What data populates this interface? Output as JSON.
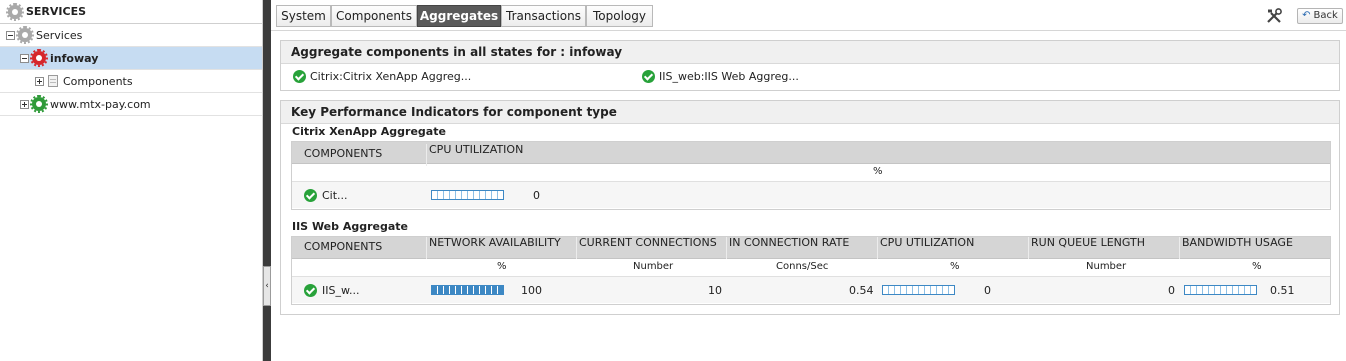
{
  "sidebar": {
    "title": "SERVICES",
    "tree": [
      {
        "label": "Services"
      },
      {
        "label": "infoway"
      },
      {
        "label": "Components"
      },
      {
        "label": "www.mtx-pay.com"
      }
    ]
  },
  "tabs": [
    {
      "label": "System"
    },
    {
      "label": "Components"
    },
    {
      "label": "Aggregates"
    },
    {
      "label": "Transactions"
    },
    {
      "label": "Topology"
    }
  ],
  "toolbar": {
    "back_label": "Back"
  },
  "aggregates_panel": {
    "title": "Aggregate components in all states for : infoway",
    "items": [
      {
        "label": "Citrix:Citrix XenApp Aggreg..."
      },
      {
        "label": "IIS_web:IIS Web Aggreg..."
      }
    ]
  },
  "kpi_panel": {
    "title": "Key Performance Indicators for component type",
    "citrix": {
      "title": "Citrix XenApp Aggregate",
      "columns": [
        "COMPONENTS",
        "CPU UTILIZATION"
      ],
      "units": [
        "",
        "%"
      ],
      "row": {
        "component": "Cit...",
        "cpu_value": "0",
        "cpu_level": 0
      }
    },
    "iis": {
      "title": "IIS Web Aggregate",
      "columns": [
        "COMPONENTS",
        "NETWORK AVAILABILITY",
        "CURRENT CONNECTIONS",
        "IN CONNECTION RATE",
        "CPU UTILIZATION",
        "RUN QUEUE LENGTH",
        "BANDWIDTH USAGE"
      ],
      "units": [
        "",
        "%",
        "Number",
        "Conns/Sec",
        "%",
        "Number",
        "%"
      ],
      "row": {
        "component": "IIS_w...",
        "network_availability": "100",
        "network_availability_level": 1.0,
        "current_connections": "10",
        "in_connection_rate": "0.54",
        "cpu_utilization": "0",
        "cpu_level": 0,
        "run_queue_length": "0",
        "bandwidth_usage": "0.51",
        "bandwidth_level": 0
      }
    }
  },
  "colors": {
    "status_ok": "#28a23a",
    "status_critical": "#d6262b",
    "selected_row": "#c6dcf2",
    "active_tab": "#5a5a5a",
    "bar": "#3d88c4"
  }
}
